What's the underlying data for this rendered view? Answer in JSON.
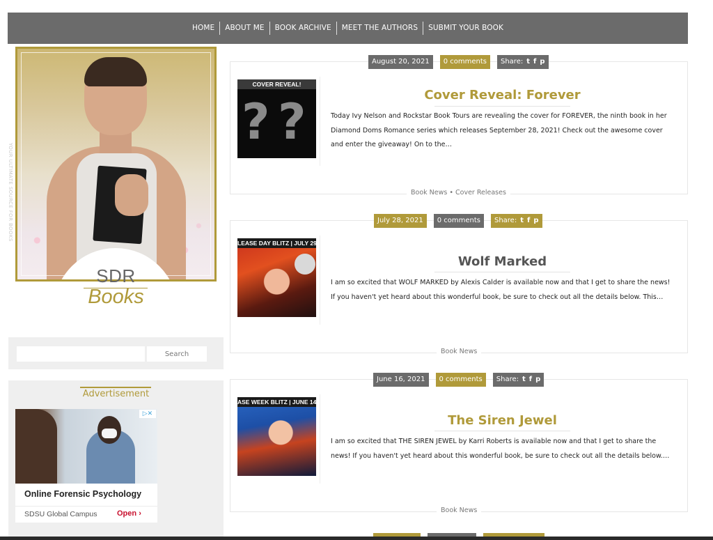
{
  "nav": {
    "items": [
      "HOME",
      "ABOUT ME",
      "BOOK ARCHIVE",
      "MEET THE AUTHORS",
      "SUBMIT YOUR BOOK"
    ]
  },
  "sidebar": {
    "vertical_text": "YOUR ULTIMATE SOURCE FOR BOOKS",
    "logo_sdr": "SDR",
    "logo_books": "Books",
    "search_placeholder": "",
    "search_button": "Search",
    "ad": {
      "title": "Advertisement",
      "choices_icon": "▷✕",
      "headline": "Online Forensic Psychology",
      "source": "SDSU Global Campus",
      "cta": "Open",
      "cta_chevron": "›"
    }
  },
  "colors": {
    "accent": "#b09a3a",
    "nav_bg": "#6b6b6b",
    "chip_gray": "#6b6b6b"
  },
  "posts": [
    {
      "date": "August 20, 2021",
      "comments": "0 comments",
      "share_label": "Share:",
      "share_icons": [
        "t",
        "f",
        "p"
      ],
      "thumb_banner": "COVER REVEAL!",
      "title": "Cover Reveal: Forever",
      "excerpt": "Today Ivy Nelson and Rockstar Book Tours are revealing the cover for FOREVER, the ninth book in her Diamond Doms Romance series which releases September 28, 2021! Check out the awesome cover and enter the giveaway!   On to the…",
      "categories": [
        "Book News",
        "Cover Releases"
      ],
      "cat_sep": " • "
    },
    {
      "date": "July 28, 2021",
      "comments": "0 comments",
      "share_label": "Share:",
      "share_icons": [
        "t",
        "f",
        "p"
      ],
      "thumb_banner": "LEASE DAY BLITZ | JULY 29",
      "title": "Wolf Marked",
      "excerpt": "I am so excited that WOLF MARKED by Alexis Calder is available now and that I get to share the news! If you haven't yet heard about this wonderful book, be sure to check out all the details below. This…",
      "categories": [
        "Book News"
      ]
    },
    {
      "date": "June 16, 2021",
      "comments": "0 comments",
      "share_label": "Share:",
      "share_icons": [
        "t",
        "f",
        "p"
      ],
      "thumb_banner": "ASE WEEK BLITZ | JUNE 14",
      "title": "The Siren Jewel",
      "excerpt": "I am so excited that THE SIREN JEWEL by Karri Roberts is available now and that I get to share the news! If you haven't yet heard about this wonderful book, be sure to check out all the details below.…",
      "categories": [
        "Book News"
      ]
    }
  ]
}
